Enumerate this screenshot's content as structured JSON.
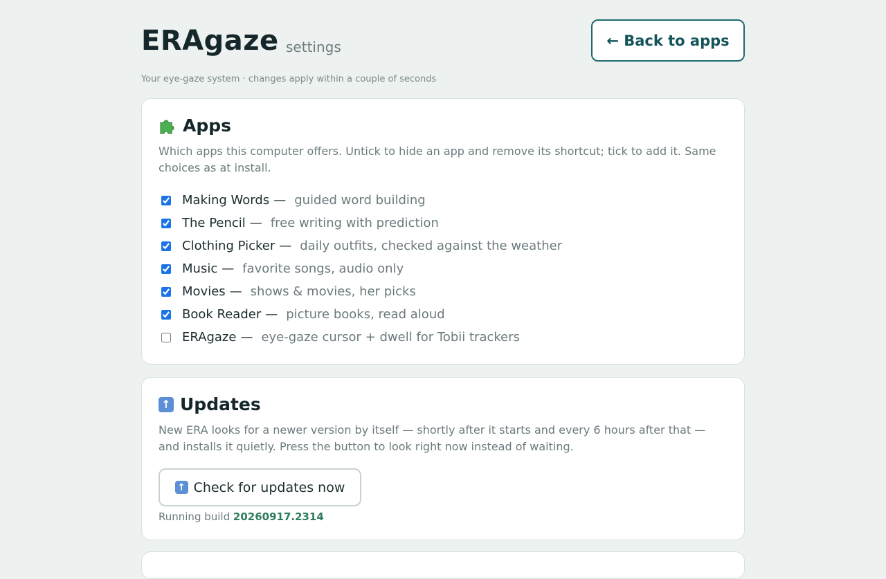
{
  "header": {
    "title": "ERAgaze",
    "subtitle": "settings",
    "tagline": "Your eye-gaze system · changes apply within a couple of seconds",
    "back_button": "← Back to apps"
  },
  "apps_section": {
    "icon": "puzzle-piece-icon",
    "title": "Apps",
    "description": "Which apps this computer offers. Untick to hide an app and remove its shortcut; tick to add it. Same choices as at install.",
    "items": [
      {
        "name": "Making Words",
        "separator": "—",
        "description": "guided word building",
        "checked": true
      },
      {
        "name": "The Pencil",
        "separator": "—",
        "description": "free writing with prediction",
        "checked": true
      },
      {
        "name": "Clothing Picker",
        "separator": "—",
        "description": "daily outfits, checked against the weather",
        "checked": true
      },
      {
        "name": "Music",
        "separator": "—",
        "description": "favorite songs, audio only",
        "checked": true
      },
      {
        "name": "Movies",
        "separator": "—",
        "description": "shows & movies, her picks",
        "checked": true
      },
      {
        "name": "Book Reader",
        "separator": "—",
        "description": "picture books, read aloud",
        "checked": true
      },
      {
        "name": "ERAgaze",
        "separator": "—",
        "description": "eye-gaze cursor + dwell for Tobii trackers",
        "checked": false
      }
    ]
  },
  "updates_section": {
    "icon": "up-arrow-icon",
    "title": "Updates",
    "description": "New ERA looks for a newer version by itself — shortly after it starts and every 6 hours after that — and installs it quietly. Press the button to look right now instead of waiting.",
    "check_button": "Check for updates now",
    "build_label": "Running build",
    "build_number": "20260917.2314"
  },
  "colors": {
    "background": "#edf1f0",
    "accent": "#1d6a6e",
    "build_number": "#2e7d5b",
    "checkbox": "#1a73e8"
  }
}
